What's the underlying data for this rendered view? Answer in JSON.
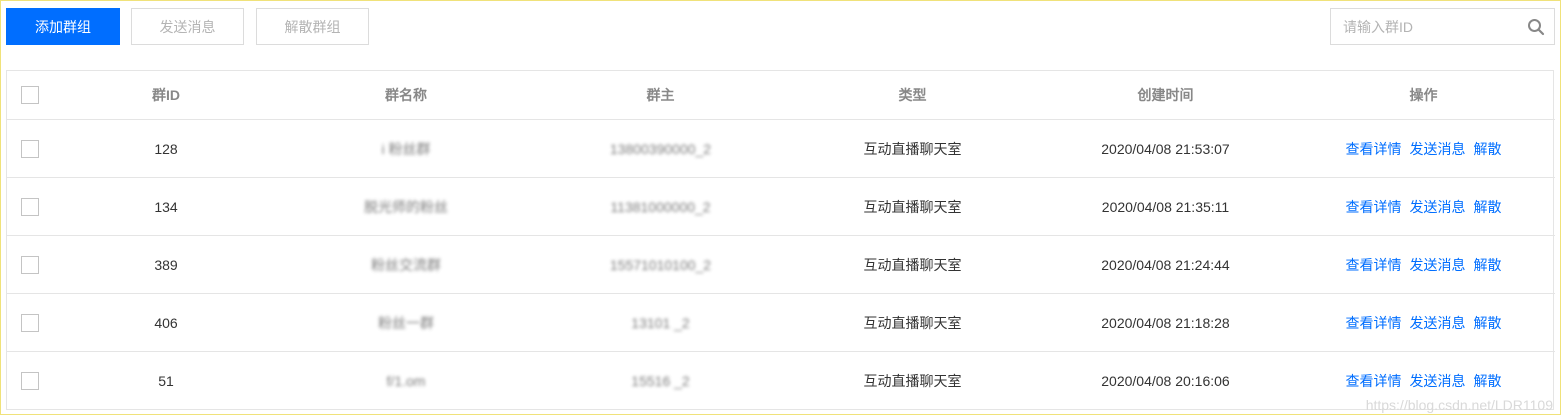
{
  "toolbar": {
    "add_group_label": "添加群组",
    "send_message_label": "发送消息",
    "dismiss_group_label": "解散群组"
  },
  "search": {
    "placeholder": "请输入群ID",
    "icon": "search-icon"
  },
  "table": {
    "headers": {
      "group_id": "群ID",
      "group_name": "群名称",
      "owner": "群主",
      "type": "类型",
      "created_at": "创建时间",
      "actions": "操作"
    },
    "rows": [
      {
        "group_id": "128",
        "group_name": "i 粉丝群",
        "owner": "13800390000_2",
        "type": "互动直播聊天室",
        "created_at": "2020/04/08 21:53:07"
      },
      {
        "group_id": "134",
        "group_name": "脱光师的粉丝",
        "owner": "11381000000_2",
        "type": "互动直播聊天室",
        "created_at": "2020/04/08 21:35:11"
      },
      {
        "group_id": "389",
        "group_name": "粉丝交流群",
        "owner": "15571010100_2",
        "type": "互动直播聊天室",
        "created_at": "2020/04/08 21:24:44"
      },
      {
        "group_id": "406",
        "group_name": "粉丝一群",
        "owner": "13101 _2",
        "type": "互动直播聊天室",
        "created_at": "2020/04/08 21:18:28"
      },
      {
        "group_id": "51",
        "group_name": "f/1.om",
        "owner": "15516 _2",
        "type": "互动直播聊天室",
        "created_at": "2020/04/08 20:16:06"
      }
    ],
    "row_actions": {
      "view_details": "查看详情",
      "send_message": "发送消息",
      "dismiss": "解散"
    }
  },
  "watermark": "https://blog.csdn.net/LDR1109"
}
